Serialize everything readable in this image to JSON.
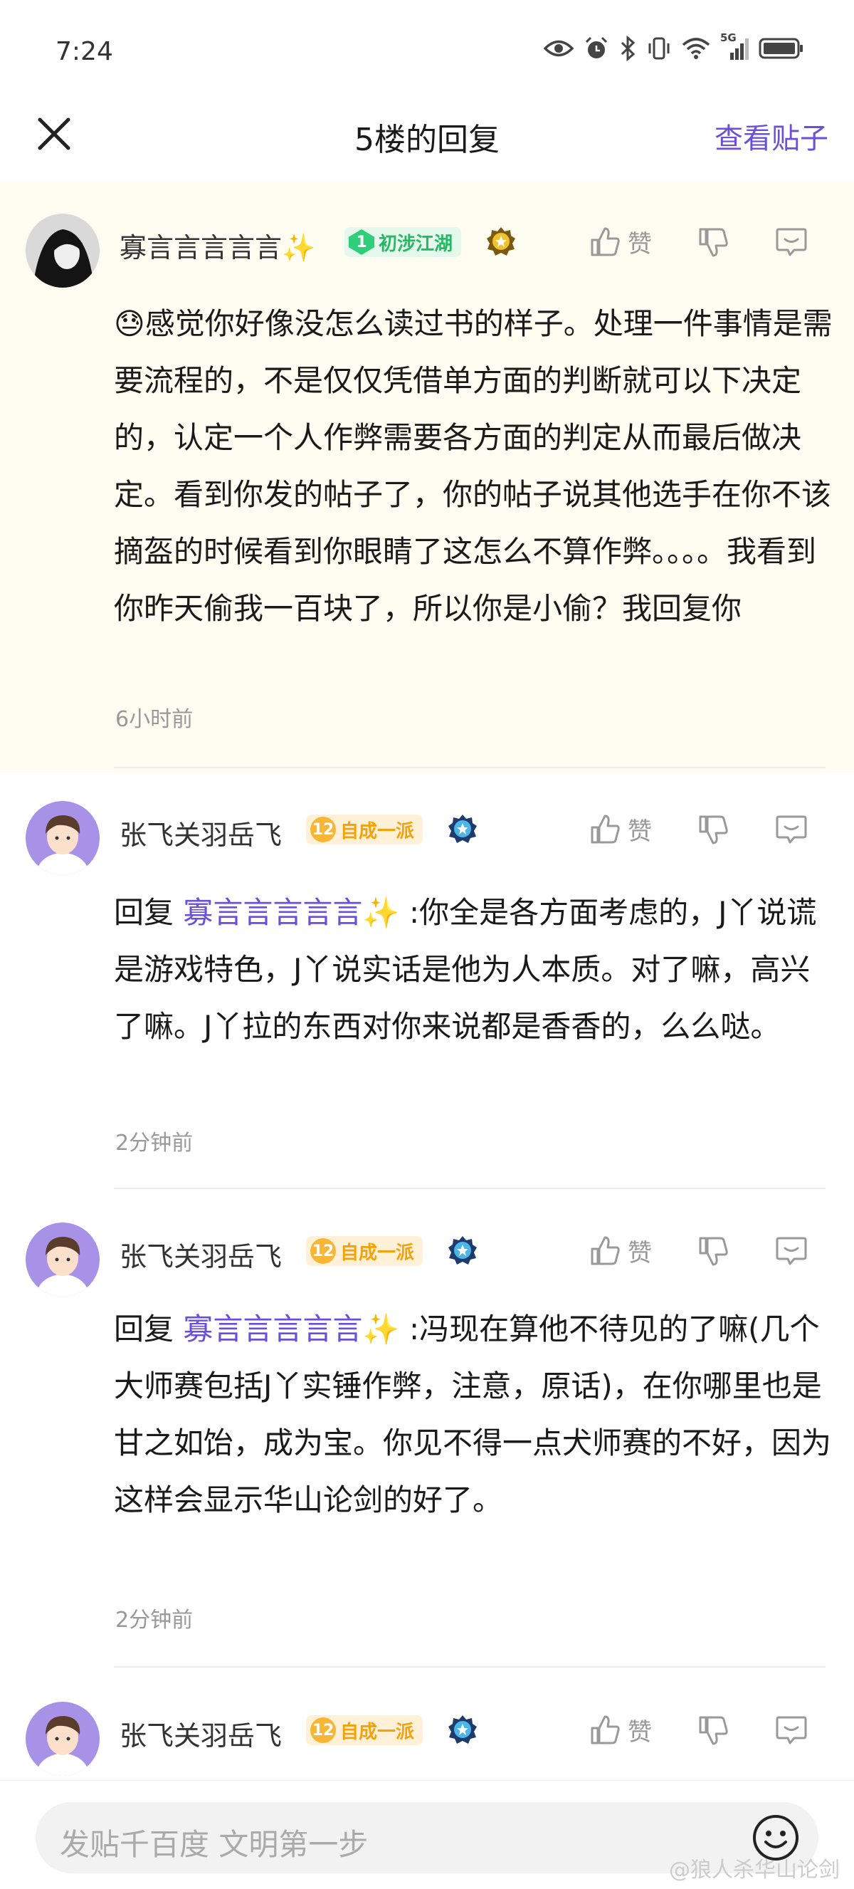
{
  "status_bar": {
    "time": "7:24",
    "signal_label": "5G"
  },
  "nav": {
    "title": "5楼的回复",
    "right_link": "查看贴子"
  },
  "replies": [
    {
      "username": "寡言言言言言✨",
      "level": "1",
      "badge": "初涉江湖",
      "like_label": "赞",
      "text": "😓感觉你好像没怎么读过书的样子。处理一件事情是需要流程的，不是仅仅凭借单方面的判断就可以下决定的，认定一个人作弊需要各方面的判定从而最后做决定。看到你发的帖子了，你的帖子说其他选手在你不该摘盔的时候看到你眼睛了这怎么不算作弊。。。。我看到你昨天偷我一百块了，所以你是小偷？我回复你",
      "time": "6小时前"
    },
    {
      "username": "张飞关羽岳飞",
      "level": "12",
      "badge": "自成一派",
      "like_label": "赞",
      "reply_prefix": "回复 ",
      "reply_to": "寡言言言言言✨",
      "text": " :你全是各方面考虑的，J丫说谎是游戏特色，J丫说实话是他为人本质。对了嘛，高兴了嘛。J丫拉的东西对你来说都是香香的，么么哒。",
      "time": "2分钟前"
    },
    {
      "username": "张飞关羽岳飞",
      "level": "12",
      "badge": "自成一派",
      "like_label": "赞",
      "reply_prefix": "回复 ",
      "reply_to": "寡言言言言言✨",
      "text": " :冯现在算他不待见的了嘛(几个大师赛包括J丫实锤作弊，注意，原话)，在你哪里也是甘之如饴，成为宝。你见不得一点犬师赛的不好，因为这样会显示华山论剑的好了。",
      "time": "2分钟前"
    },
    {
      "username": "张飞关羽岳飞",
      "level": "12",
      "badge": "自成一派",
      "like_label": "赞"
    }
  ],
  "composer": {
    "placeholder": "发贴千百度 文明第一步",
    "watermark": "@狼人杀华山论剑"
  },
  "colors": {
    "accent": "#6b4fd8",
    "highlight_bg": "#fffdf1",
    "badge_green": "#27b866",
    "badge_orange": "#f2a20c"
  }
}
